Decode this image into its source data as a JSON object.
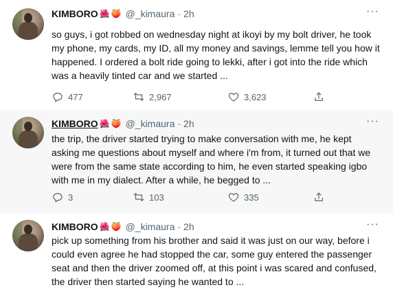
{
  "tweets": [
    {
      "name": "KIMBORO",
      "emoji1": "🌺",
      "emoji2": "🍑",
      "handle": "@_kimaura",
      "time": "2h",
      "text": "so guys, i got robbed on wednesday night at ikoyi by my bolt driver, he took my phone, my cards, my ID, all my money and savings, lemme tell you how it happened. I ordered a bolt ride going to lekki, after i got into the ride which was a heavily tinted car and we started ...",
      "replies": "477",
      "retweets": "2,967",
      "likes": "3,623"
    },
    {
      "name": "KIMBORO",
      "emoji1": "🌺",
      "emoji2": "🍑",
      "handle": "@_kimaura",
      "time": "2h",
      "text": "the trip, the driver started trying to make conversation with me, he kept asking me questions about myself and where i'm from, it turned out that we were from the same state according to him, he even started speaking igbo with me in my dialect. After a while, he begged to ...",
      "replies": "3",
      "retweets": "103",
      "likes": "335"
    },
    {
      "name": "KIMBORO",
      "emoji1": "🌺",
      "emoji2": "🍑",
      "handle": "@_kimaura",
      "time": "2h",
      "text": "pick up something from his brother and said it was just on our way, before i could even agree he had stopped the car, some guy entered the passenger seat and then the driver zoomed off, at this point i was scared and confused, the driver then started saying he wanted to ..."
    }
  ],
  "separator": "·",
  "more_label": "···",
  "icons": {
    "reply": "reply-icon",
    "retweet": "retweet-icon",
    "like": "like-icon",
    "share": "share-icon",
    "more": "more-icon"
  },
  "colors": {
    "text": "#0f1419",
    "muted": "#536471",
    "highlight_bg": "#f7f7f7"
  }
}
